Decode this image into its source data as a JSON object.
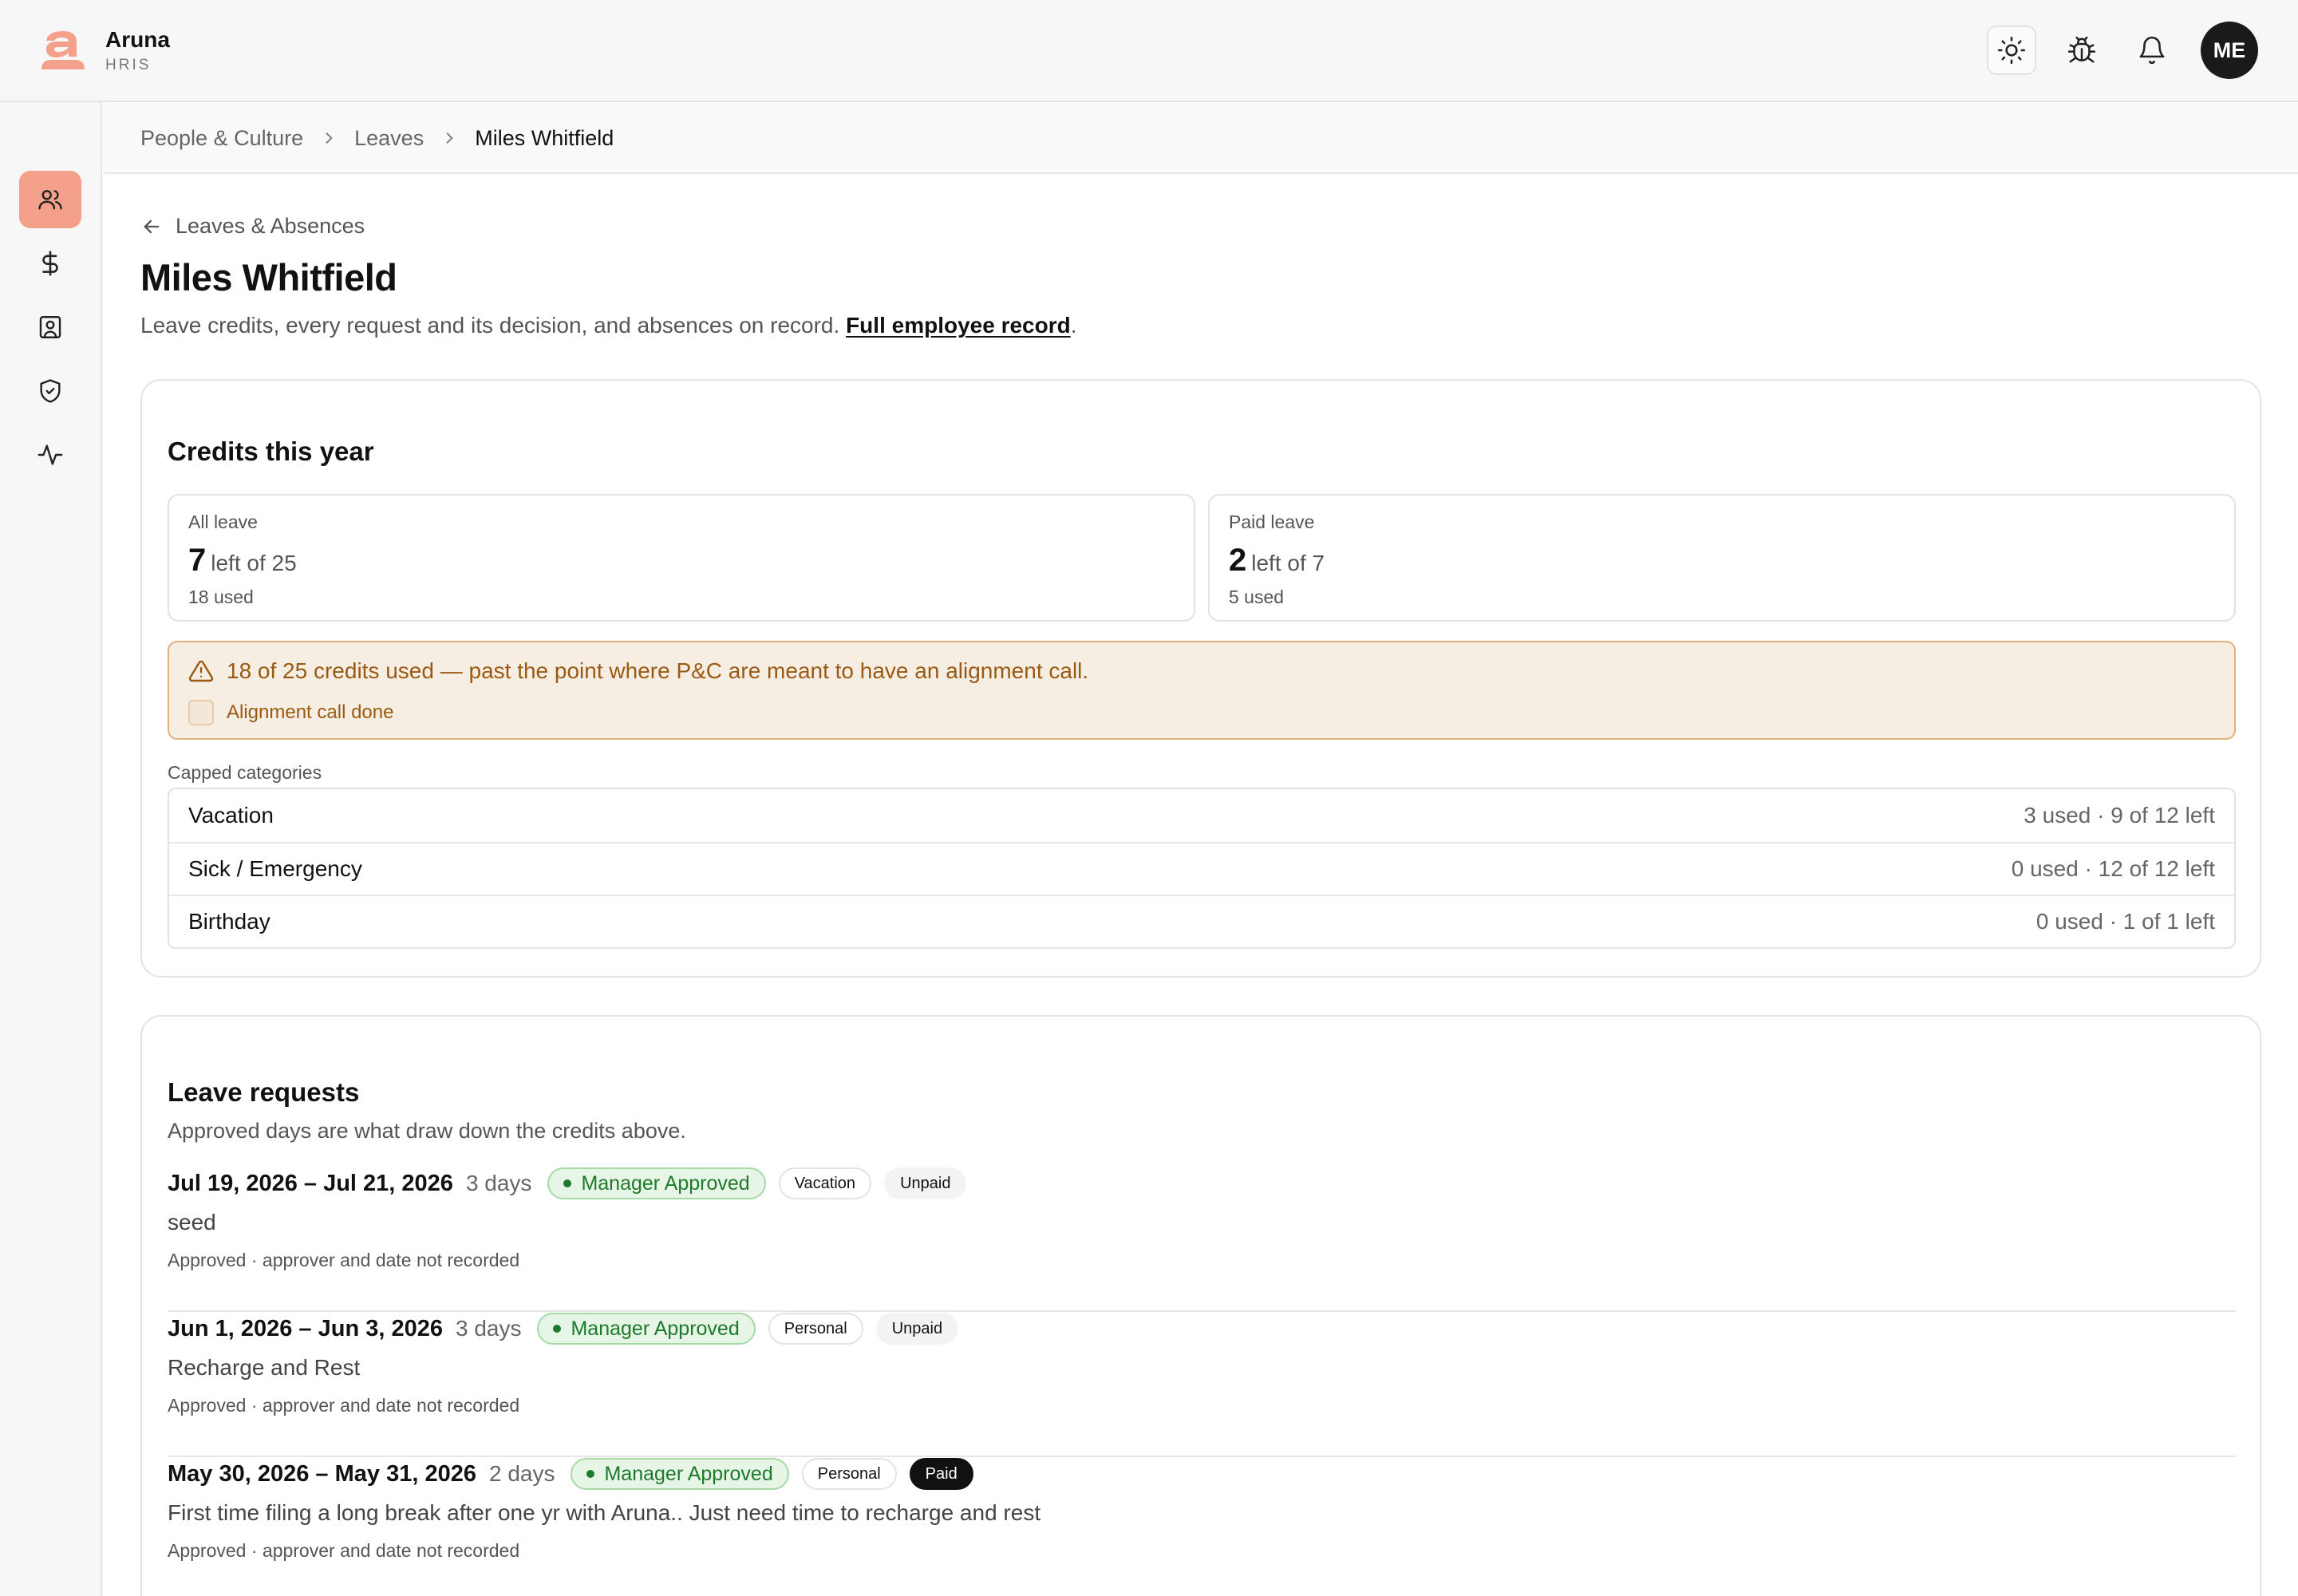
{
  "brand": {
    "name": "Aruna",
    "sub": "HRIS"
  },
  "topbar": {
    "avatar_initials": "ME",
    "icons": [
      "sun-icon",
      "bug-icon",
      "bell-icon"
    ]
  },
  "sidebar": {
    "items": [
      "people-icon",
      "dollar-icon",
      "contact-icon",
      "shield-icon",
      "activity-icon"
    ]
  },
  "breadcrumb": [
    "People & Culture",
    "Leaves",
    "Miles Whitfield"
  ],
  "page": {
    "back_label": "Leaves & Absences",
    "title": "Miles Whitfield",
    "description": "Leave credits, every request and its decision, and absences on record.",
    "record_link": "Full employee record",
    "description_end": "."
  },
  "credits": {
    "title": "Credits this year",
    "all": {
      "label": "All leave",
      "left": "7",
      "of_text": "left of 25",
      "used": "18 used"
    },
    "paid": {
      "label": "Paid leave",
      "left": "2",
      "of_text": "left of 7",
      "used": "5 used"
    },
    "alert": {
      "message": "18 of 25 credits used — past the point where P&C are meant to have an alignment call.",
      "checkbox_label": "Alignment call done"
    },
    "capped_label": "Capped categories",
    "capped": [
      {
        "name": "Vacation",
        "value": "3 used · 9 of 12 left"
      },
      {
        "name": "Sick / Emergency",
        "value": "0 used · 12 of 12 left"
      },
      {
        "name": "Birthday",
        "value": "0 used · 1 of 1 left"
      }
    ]
  },
  "requests": {
    "title": "Leave requests",
    "subtitle": "Approved days are what draw down the credits above.",
    "items": [
      {
        "dates": "Jul 19, 2026 – Jul 21, 2026",
        "days": "3 days",
        "status": "Manager Approved",
        "type": "Vacation",
        "pay": "Unpaid",
        "note": "seed",
        "meta": "Approved · approver and date not recorded"
      },
      {
        "dates": "Jun 1, 2026 – Jun 3, 2026",
        "days": "3 days",
        "status": "Manager Approved",
        "type": "Personal",
        "pay": "Unpaid",
        "note": "Recharge and Rest",
        "meta": "Approved · approver and date not recorded"
      },
      {
        "dates": "May 30, 2026 – May 31, 2026",
        "days": "2 days",
        "status": "Manager Approved",
        "type": "Personal",
        "pay": "Paid",
        "note": "First time filing a long break after one yr with Aruna.. Just need time to recharge and rest",
        "meta": "Approved · approver and date not recorded"
      }
    ]
  },
  "colors": {
    "accent": "#f5a08a",
    "warning_bg": "#f6ede3",
    "warning_text": "#9a5a12",
    "approved": "#1d7a2b"
  }
}
